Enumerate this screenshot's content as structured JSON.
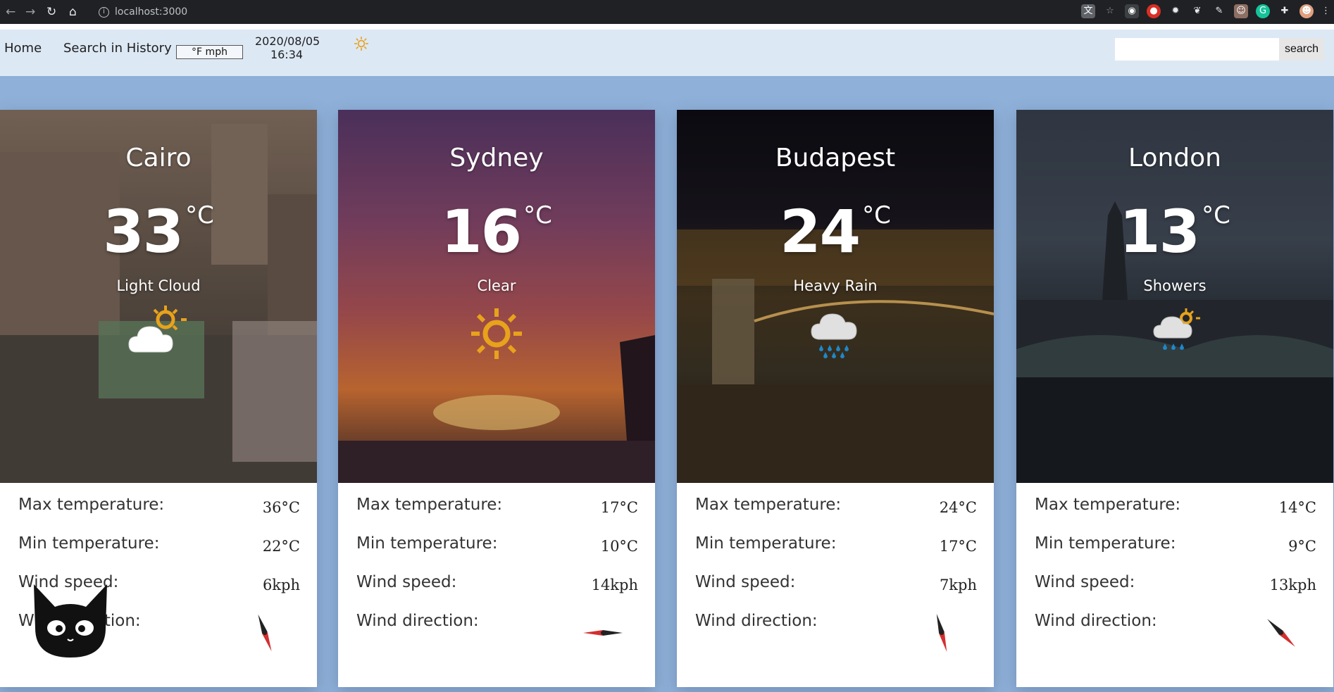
{
  "browser": {
    "url": "localhost:3000",
    "back_icon": "arrow-left",
    "forward_icon": "arrow-right",
    "reload_icon": "reload",
    "home_icon": "home"
  },
  "header": {
    "nav": [
      {
        "label": "Home"
      },
      {
        "label": "Search in History"
      }
    ],
    "unit_toggle": "°F mph",
    "date": "2020/08/05",
    "time": "16:34",
    "search": {
      "value": "",
      "button": "search"
    },
    "icon": "sun-icon"
  },
  "labels": {
    "max": "Max temperature:",
    "min": "Min temperature:",
    "wind_speed": "Wind speed:",
    "wind_dir": "Wind direction:"
  },
  "cities": [
    {
      "name": "Cairo",
      "temp": "33",
      "unit": "°C",
      "condition": "Light Cloud",
      "max": "36°C",
      "min": "22°C",
      "wind": "6kph",
      "wind_dir_deg": 160,
      "icon": "light-cloud-icon"
    },
    {
      "name": "Sydney",
      "temp": "16",
      "unit": "°C",
      "condition": "Clear",
      "max": "17°C",
      "min": "10°C",
      "wind": "14kph",
      "wind_dir_deg": 270,
      "icon": "sun-icon"
    },
    {
      "name": "Budapest",
      "temp": "24",
      "unit": "°C",
      "condition": "Heavy Rain",
      "max": "24°C",
      "min": "17°C",
      "wind": "7kph",
      "wind_dir_deg": 165,
      "icon": "heavy-rain-icon"
    },
    {
      "name": "London",
      "temp": "13",
      "unit": "°C",
      "condition": "Showers",
      "max": "14°C",
      "min": "9°C",
      "wind": "13kph",
      "wind_dir_deg": 135,
      "icon": "showers-icon"
    }
  ],
  "colors": {
    "header_bg": "#dde8f5",
    "page_bg": "#8fb0d8",
    "sun": "#e8a21b",
    "rain": "#1e88c8",
    "compass_red": "#d32f2f"
  }
}
